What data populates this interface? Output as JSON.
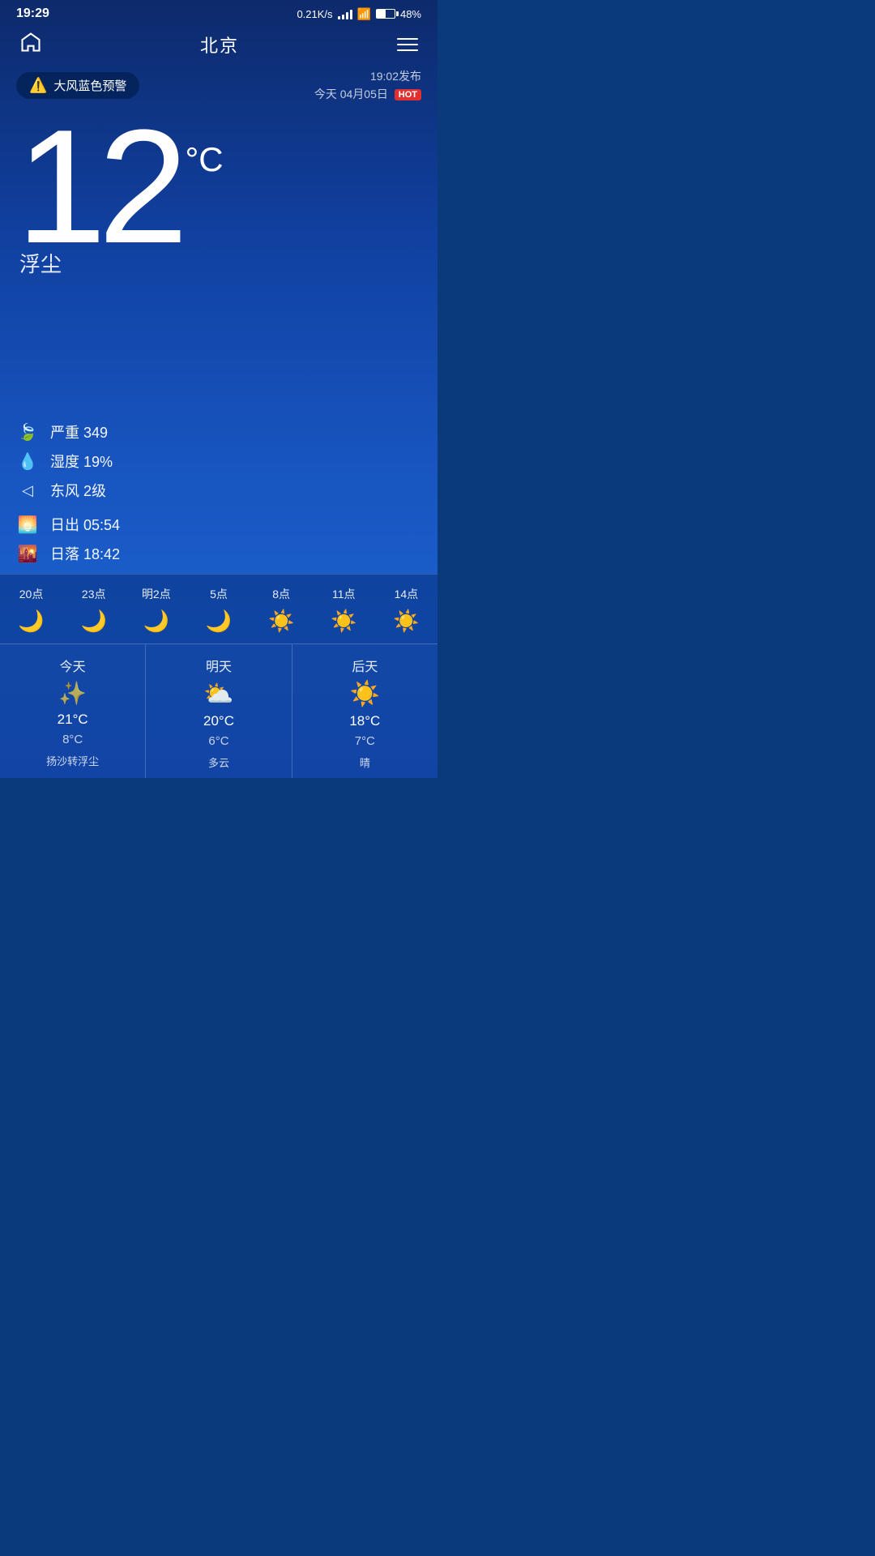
{
  "statusBar": {
    "time": "19:29",
    "network": "0.21K/s",
    "battery": "48%"
  },
  "header": {
    "city": "北京",
    "homeIcon": "home-icon",
    "menuIcon": "menu-icon"
  },
  "alert": {
    "label": "大风蓝色预警",
    "publishTime": "19:02发布",
    "date": "今天 04月05日",
    "hotBadge": "HOT"
  },
  "current": {
    "temperature": "12",
    "unit": "°C",
    "description": "浮尘"
  },
  "details": {
    "aqi": {
      "icon": "🍃",
      "label": "严重 349"
    },
    "humidity": {
      "icon": "💧",
      "label": "湿度 19%"
    },
    "wind": {
      "icon": "◁",
      "label": "东风 2级"
    },
    "sunrise": {
      "icon": "🌅",
      "label": "日出  05:54"
    },
    "sunset": {
      "icon": "🌇",
      "label": "日落  18:42"
    }
  },
  "hourly": [
    {
      "time": "20点",
      "icon": "moon",
      "temp": ""
    },
    {
      "time": "23点",
      "icon": "moon",
      "temp": ""
    },
    {
      "time": "明2点",
      "icon": "moon",
      "temp": ""
    },
    {
      "time": "5点",
      "icon": "moon",
      "temp": ""
    },
    {
      "time": "8点",
      "icon": "sun",
      "temp": ""
    },
    {
      "time": "11点",
      "icon": "sun",
      "temp": ""
    },
    {
      "time": "14点",
      "icon": "sun",
      "temp": ""
    }
  ],
  "daily": [
    {
      "day": "今天",
      "icon": "dusty",
      "high": "21°C",
      "low": "8°C",
      "desc": "扬沙转浮尘"
    },
    {
      "day": "明天",
      "icon": "cloudy-sun",
      "high": "20°C",
      "low": "6°C",
      "desc": "多云"
    },
    {
      "day": "后天",
      "icon": "sunny",
      "high": "18°C",
      "low": "7°C",
      "desc": "晴"
    }
  ]
}
